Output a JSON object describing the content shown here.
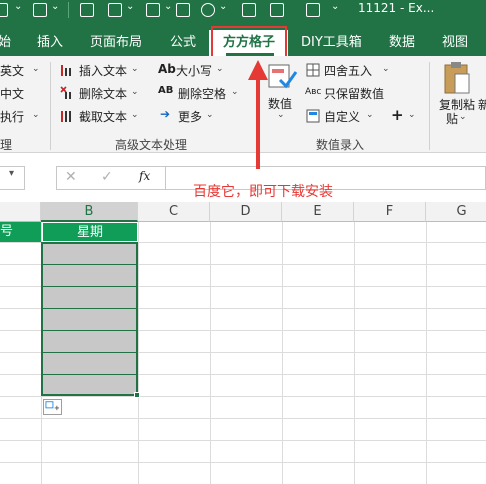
{
  "window": {
    "title": "11121 - Ex..."
  },
  "tabs": [
    {
      "label": "始"
    },
    {
      "label": "插入"
    },
    {
      "label": "页面布局"
    },
    {
      "label": "公式"
    },
    {
      "label": "方方格子",
      "active": true
    },
    {
      "label": "DIY工具箱"
    },
    {
      "label": "数据"
    },
    {
      "label": "视图"
    }
  ],
  "ribbon": {
    "left_partial": [
      "英文",
      "中文",
      "执行"
    ],
    "text_tools": {
      "insert_text": "插入文本",
      "delete_text": "删除文本",
      "extract_text": "截取文本",
      "case": "大小写",
      "delete_spaces": "删除空格",
      "more": "更多",
      "ab_glyph": "Ab",
      "ab2_glyph": "AB"
    },
    "number_tools": {
      "value_btn_line1": "数值",
      "round": "四舍五入",
      "keep_numeric": "只保留数值",
      "custom": "自定义",
      "plus": "+",
      "abc_glyph": "Aʙc"
    },
    "clipboard": {
      "copy_paste_line1": "复制粘",
      "copy_paste_line2": "贴",
      "cut_partial": "新"
    },
    "group_labels": {
      "left_partial": "理",
      "advanced_text": "高级文本处理",
      "number_entry": "数值录入"
    }
  },
  "formula_bar": {
    "cancel": "✕",
    "confirm": "✓",
    "fx": "fx",
    "value": ""
  },
  "annotation": {
    "text": "百度它，即可下载安装",
    "color": "#e53935"
  },
  "sheet": {
    "columns": [
      "B",
      "C",
      "D",
      "E",
      "F",
      "G"
    ],
    "header_row": {
      "col_a_partial": "号",
      "col_b": "星期"
    }
  },
  "colors": {
    "excel_green": "#217346",
    "header_fill": "#0f9d58",
    "selection_fill": "#c8c8c8",
    "highlight": "#e53935"
  }
}
